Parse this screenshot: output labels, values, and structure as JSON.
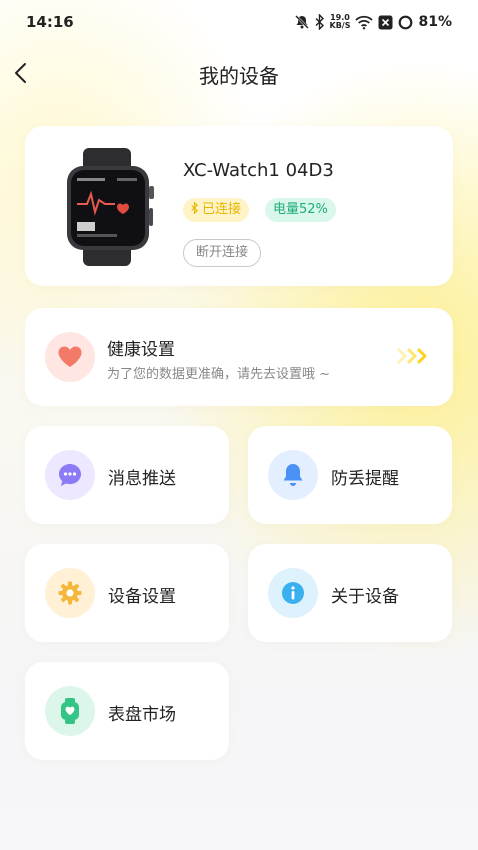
{
  "status_bar": {
    "time": "14:16",
    "net_speed_value": "19.0",
    "net_speed_unit": "KB/S",
    "battery": "81%"
  },
  "header": {
    "title": "我的设备"
  },
  "device": {
    "name": "XC-Watch1 04D3",
    "connected_label": "已连接",
    "battery_label": "电量52%",
    "disconnect_label": "断开连接"
  },
  "health": {
    "title": "健康设置",
    "subtitle": "为了您的数据更准确，请先去设置哦 ~"
  },
  "tiles": [
    {
      "label": "消息推送",
      "icon": "message-icon",
      "color": "#8b7cf6"
    },
    {
      "label": "防丢提醒",
      "icon": "bell-icon",
      "color": "#4a90f5"
    },
    {
      "label": "设备设置",
      "icon": "gear-icon",
      "color": "#f5b73b"
    },
    {
      "label": "关于设备",
      "icon": "info-icon",
      "color": "#3ab0f0"
    },
    {
      "label": "表盘市场",
      "icon": "watch-face-icon",
      "color": "#34c486"
    }
  ],
  "colors": {
    "accent_yellow": "#ffd21f",
    "health_red": "#f47a68",
    "connected_text": "#e8b500",
    "battery_text": "#1fae7a"
  }
}
